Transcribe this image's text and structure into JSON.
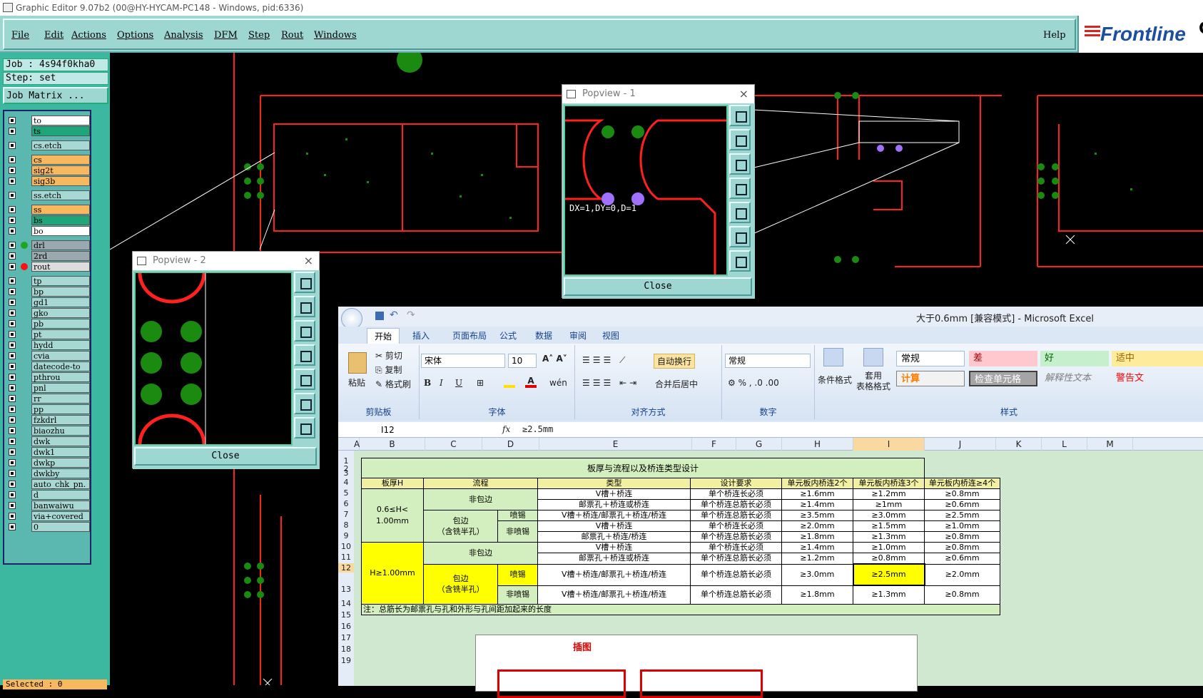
{
  "window_title": "Graphic Editor 9.07b2 (00@HY-HYCAM-PC148 - Windows, pid:6336)",
  "menu": [
    "File",
    "Edit",
    "Actions",
    "Options",
    "Analysis",
    "DFM",
    "Step",
    "Rout",
    "Windows"
  ],
  "help_label": "Help",
  "logo_text": "Frontline",
  "logo_clip": "C",
  "job_label": "Job : 4s94f0kha0",
  "step_label": "Step: set",
  "job_matrix_label": "Job Matrix ...",
  "selected_label": "Selected : 0",
  "layers": [
    {
      "name": "to",
      "color": "#ffffff"
    },
    {
      "name": "ts",
      "color": "#1ea67a"
    },
    {
      "name": "cs.etch",
      "color": "#a8d8d4"
    },
    {
      "name": "cs",
      "color": "#f8b860"
    },
    {
      "name": "sig2t",
      "color": "#f8b860"
    },
    {
      "name": "sig3b",
      "color": "#f8b860"
    },
    {
      "name": "ss.etch",
      "color": "#a8d8d4"
    },
    {
      "name": "ss",
      "color": "#f8b860"
    },
    {
      "name": "bs",
      "color": "#1ea67a"
    },
    {
      "name": "bo",
      "color": "#ffffff"
    },
    {
      "name": "drl",
      "color": "#9aa8b0"
    },
    {
      "name": "2rd",
      "color": "#9aa8b0"
    },
    {
      "name": "rout",
      "color": "#dcdcdc"
    },
    {
      "name": "tp",
      "color": "#a8d8d4"
    },
    {
      "name": "bp",
      "color": "#a8d8d4"
    },
    {
      "name": "gd1",
      "color": "#a8d8d4"
    },
    {
      "name": "gko",
      "color": "#a8d8d4"
    },
    {
      "name": "pb",
      "color": "#a8d8d4"
    },
    {
      "name": "pt",
      "color": "#a8d8d4"
    },
    {
      "name": "hydd",
      "color": "#a8d8d4"
    },
    {
      "name": "cvia",
      "color": "#a8d8d4"
    },
    {
      "name": "datecode-to",
      "color": "#a8d8d4"
    },
    {
      "name": "pthrou",
      "color": "#a8d8d4"
    },
    {
      "name": "pnl",
      "color": "#a8d8d4"
    },
    {
      "name": "rr",
      "color": "#a8d8d4"
    },
    {
      "name": "pp",
      "color": "#a8d8d4"
    },
    {
      "name": "fzkdrl",
      "color": "#a8d8d4"
    },
    {
      "name": "biaozhu",
      "color": "#a8d8d4"
    },
    {
      "name": "dwk",
      "color": "#a8d8d4"
    },
    {
      "name": "dwk1",
      "color": "#a8d8d4"
    },
    {
      "name": "dwkp",
      "color": "#a8d8d4"
    },
    {
      "name": "dwkby",
      "color": "#a8d8d4"
    },
    {
      "name": "auto_chk_pn.",
      "color": "#a8d8d4"
    },
    {
      "name": "d",
      "color": "#a8d8d4"
    },
    {
      "name": "banwaiwu",
      "color": "#a8d8d4"
    },
    {
      "name": "via+covered",
      "color": "#a8d8d4"
    },
    {
      "name": "0",
      "color": "#a8d8d4"
    }
  ],
  "popview1": {
    "title": "Popview - 1",
    "measure": "DX=1,DY=0,D=1",
    "close": "Close"
  },
  "popview2": {
    "title": "Popview - 2",
    "close": "Close"
  },
  "excel": {
    "title": "大于0.6mm [兼容模式] - Microsoft Excel",
    "tabs": [
      "开始",
      "插入",
      "页面布局",
      "公式",
      "数据",
      "审阅",
      "视图"
    ],
    "clipboard": {
      "paste": "粘贴",
      "cut": "剪切",
      "copy": "复制",
      "format_painter": "格式刷",
      "group": "剪贴板"
    },
    "font": {
      "name": "宋体",
      "size": "10",
      "group": "字体"
    },
    "align": {
      "wrap": "自动换行",
      "merge": "合并后居中",
      "group": "对齐方式"
    },
    "number": {
      "format": "常规",
      "group": "数字"
    },
    "styles": {
      "cond": "条件格式",
      "table": "套用\n表格格式",
      "normal": "常规",
      "bad": "差",
      "good": "好",
      "neutral": "适中",
      "calc": "计算",
      "check": "检查单元格",
      "explain": "解释性文本",
      "warn": "警告文",
      "group": "样式"
    },
    "namebox": "I12",
    "formula": "≥2.5mm",
    "columns": [
      "A",
      "B",
      "C",
      "D",
      "E",
      "F",
      "G",
      "H",
      "I",
      "J",
      "K",
      "L",
      "M"
    ],
    "rows": [
      "1",
      "2",
      "3",
      "4",
      "5",
      "6",
      "7",
      "8",
      "9",
      "10",
      "11",
      "12",
      "13",
      "14",
      "15",
      "16",
      "17",
      "18",
      "19"
    ],
    "sheet_title": "板厚与流程以及桥连类型设计",
    "headers": [
      "板厚H",
      "流程",
      "类型",
      "设计要求",
      "单元板内桥连2个",
      "单元板内桥连3个",
      "单元板内桥连≥4个"
    ],
    "thick1": "0.6≤H<\n1.00mm",
    "thick2": "H≥1.00mm",
    "fbb": "非包边",
    "bb": "包边\n（含铣半孔）",
    "px": "喷锡",
    "fpx": "非喷锡",
    "data_rows": [
      [
        "V槽＋桥连",
        "单个桥连长必须",
        "≥1.6mm",
        "≥1.2mm",
        "≥0.8mm"
      ],
      [
        "邮票孔＋桥连或桥连",
        "单个桥连总筋长必须",
        "≥1.4mm",
        "≥1mm",
        "≥0.6mm"
      ],
      [
        "V槽＋桥连/邮票孔＋桥连/桥连",
        "单个桥连总筋长必须",
        "≥3.5mm",
        "≥3.0mm",
        "≥2.5mm"
      ],
      [
        "V槽＋桥连",
        "单个桥连长必须",
        "≥2.0mm",
        "≥1.5mm",
        "≥1.0mm"
      ],
      [
        "邮票孔＋桥连/桥连",
        "单个桥连总筋长必须",
        "≥1.8mm",
        "≥1.3mm",
        "≥0.8mm"
      ],
      [
        "V槽＋桥连",
        "单个桥连长必须",
        "≥1.4mm",
        "≥1.0mm",
        "≥0.8mm"
      ],
      [
        "邮票孔＋桥连或桥连",
        "单个桥连总筋长必须",
        "≥1.2mm",
        "≥0.8mm",
        "≥0.6mm"
      ],
      [
        "V槽＋桥连/邮票孔＋桥连/桥连",
        "单个桥连总筋长必须",
        "≥3.0mm",
        "≥2.5mm",
        "≥2.0mm"
      ],
      [
        "V槽＋桥连/邮票孔＋桥连/桥连",
        "单个桥连总筋长必须",
        "≥1.8mm",
        "≥1.3mm",
        "≥0.8mm"
      ]
    ],
    "note": "注：总筋长为邮票孔与孔和外形与孔间距加起来的长度",
    "picture_label": "插图"
  }
}
